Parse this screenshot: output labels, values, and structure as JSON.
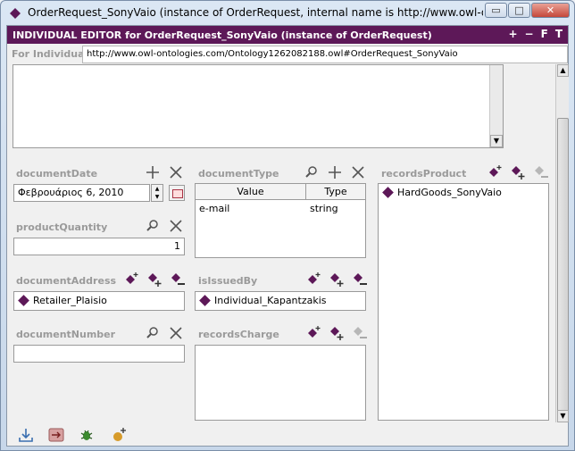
{
  "window": {
    "title": "OrderRequest_SonyVaio   (instance of OrderRequest, internal name is http://www.owl-ontolog...",
    "buttons": {
      "minimize": "▭",
      "maximize": "□",
      "close": "✕"
    }
  },
  "editor": {
    "header": "INDIVIDUAL EDITOR for OrderRequest_SonyVaio  (instance of OrderRequest)",
    "header_tools": [
      "+",
      "−",
      "F",
      "T"
    ],
    "for_individual_label": "For Individual:",
    "for_individual_uri": "http://www.owl-ontologies.com/Ontology1262082188.owl#OrderRequest_SonyVaio"
  },
  "slots": {
    "documentDate": {
      "name": "documentDate",
      "value": "Φεβρουάριος 6, 2010"
    },
    "productQuantity": {
      "name": "productQuantity",
      "value": "1"
    },
    "documentAddressee": {
      "name": "documentAddressee",
      "items": [
        "Retailer_Plaisio"
      ]
    },
    "documentNumber": {
      "name": "documentNumber",
      "value": ""
    },
    "documentType": {
      "name": "documentType",
      "columns": [
        "Value",
        "Type"
      ],
      "rows": [
        [
          "e-mail",
          "string"
        ]
      ]
    },
    "isIssuedBy": {
      "name": "isIssuedBy",
      "items": [
        "Individual_Kapantzakis"
      ]
    },
    "recordsCharge": {
      "name": "recordsCharge",
      "items": []
    },
    "recordsProduct": {
      "name": "recordsProduct",
      "items": [
        "HardGoods_SonyVaio"
      ]
    }
  },
  "colors": {
    "brand": "#5d1858"
  },
  "icons": [
    "diamond-icon",
    "add-icon",
    "remove-icon",
    "search-icon",
    "create-instance-icon",
    "add-existing-icon",
    "remove-value-icon",
    "calendar-icon",
    "import-icon",
    "arrow-icon",
    "bug-icon",
    "new-instance-icon"
  ]
}
